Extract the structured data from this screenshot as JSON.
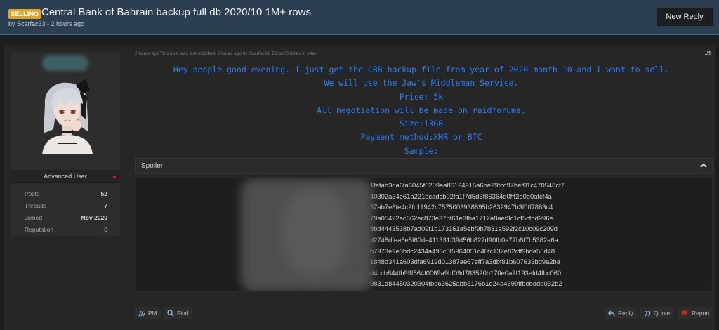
{
  "thread": {
    "badge": "SELLING",
    "title": "Central Bank of Bahrain backup full db 2020/10 1M+ rows",
    "meta": "by Scarfac33 - 2 hours ago",
    "new_reply_label": "New Reply"
  },
  "user": {
    "role": "Advanced User",
    "stats": [
      {
        "label": "Posts",
        "value": "52"
      },
      {
        "label": "Threads",
        "value": "7"
      },
      {
        "label": "Joined",
        "value": "Nov 2020"
      },
      {
        "label": "Reputation",
        "value": "0"
      }
    ]
  },
  "post": {
    "meta": "2 hours ago   This post was last modified: 2 hours ago by Scarfac33. Edited 5 times in total.",
    "number": "#1",
    "lines": [
      "Hey people good evening. I just get the CBB backup file from year of 2020 month 10 and I want to sell.",
      "We will use the Jaw's Middleman Service.",
      "Price: 5k",
      "All negotiation will be made on raidforums.",
      "Size:13GB",
      "Payment method:XMR or BTC",
      "Sample:"
    ],
    "spoiler_label": "Spoiler",
    "hash_lines": [
      "1fefab3da6fa6045f6209aa85124915a6be29fcc97bef01c470548cf7",
      "40302a34e61a221bcadcb02fa1f7d5d3f86364d0fff2e0e0afcf4a",
      "57ab7e8fe4c2fc11942c7575003938895b2632947b3f0ff7863c4",
      "79a05422ac662ec873e37bf61e3fba1712a8aef3c1cf5cfbd996e",
      "8bd4443538b7ad09f1b173161a5ebf9b7b31a592f2c10c09c209d",
      "d2748dfea6e5f60de411331f39d56b827d90fb0a77b8f7b5382a6a",
      "b7973e9e3bdc2434a493c5f5964051c40fc132e82cff9bda55d48",
      "1848d341a603dfa6919d01387ae67eff7a3dbf81b607633bd9a2ba",
      "d4ccb844fb99f564f0069a9bf09d783520b170e0a2f193efd4fbc060",
      "9831d84450320304fbd63625abb3176b1e24a4699ffbebddd032b2"
    ]
  },
  "actions": {
    "pm": "PM",
    "find": "Find",
    "reply": "Reply",
    "quote": "Quote",
    "report": "Report"
  },
  "colors": {
    "header_bg": "#2c3e52",
    "badge": "#d9a52d",
    "post_text": "#2a7cf5",
    "online_dot": "#b52a2a",
    "report_flag": "#c62828"
  },
  "icons": [
    "chevron-up-icon",
    "pm-icon",
    "search-icon",
    "reply-icon",
    "quote-icon",
    "flag-icon"
  ]
}
